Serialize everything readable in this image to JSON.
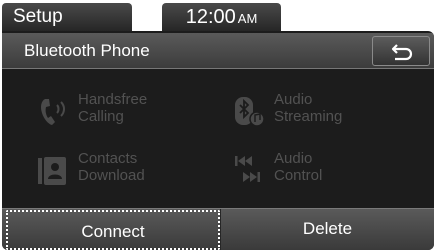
{
  "status": {
    "setup_label": "Setup",
    "time": "12:00",
    "ampm": "AM"
  },
  "header": {
    "title": "Bluetooth Phone",
    "back_icon": "back-arrow-icon"
  },
  "menu": {
    "items": [
      {
        "label": "Handsfree\nCalling",
        "icon": "phone-icon",
        "enabled": false
      },
      {
        "label": "Audio\nStreaming",
        "icon": "bluetooth-music-icon",
        "enabled": false
      },
      {
        "label": "Contacts\nDownload",
        "icon": "contacts-icon",
        "enabled": false
      },
      {
        "label": "Audio\nControl",
        "icon": "skip-controls-icon",
        "enabled": false
      }
    ]
  },
  "buttons": {
    "connect_label": "Connect",
    "delete_label": "Delete"
  },
  "colors": {
    "panel": "#1c1c1c",
    "disabled_text": "#525252",
    "text": "#ffffff"
  }
}
